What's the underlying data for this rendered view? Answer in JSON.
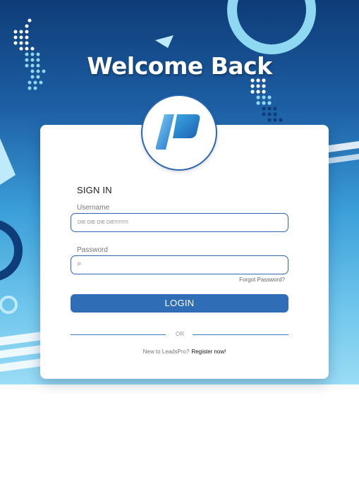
{
  "page": {
    "heading": "Welcome Back"
  },
  "form": {
    "title": "SIGN IN",
    "username_label": "Username",
    "username_value": "DIE DIE DIE DIE!!!!!!!!!!",
    "password_label": "Password",
    "password_value": "P",
    "forgot_password": "Forgot Password?",
    "login_button": "LOGIN",
    "divider_text": "OR",
    "new_user_prompt": "New to LeadsPro?",
    "register_link": "Register now!"
  },
  "icons": {
    "logo": "leadspro-logo-icon"
  },
  "colors": {
    "brand_blue": "#2f6db6",
    "dark_navy": "#0f3d7a",
    "light_cyan": "#8fd8f2",
    "card_bg": "#ffffff"
  }
}
